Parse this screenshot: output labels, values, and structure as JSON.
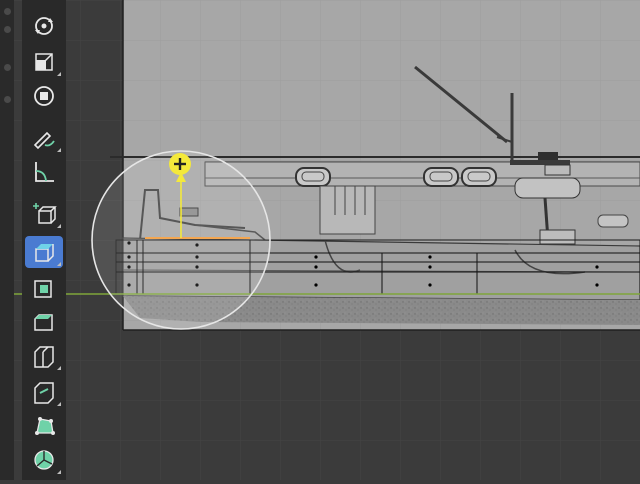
{
  "app": {
    "editor": "3D viewport"
  },
  "colors": {
    "viewport_bg": "#3b3b3b",
    "toolbar_bg": "#292929",
    "active_tool": "#4a7bd1",
    "x_axis": "#7fa63a",
    "gizmo": "#f4e93b",
    "edge_selected": "#f39b3b"
  },
  "toolbar": {
    "tools": [
      {
        "name": "tool-transform-pivot",
        "icon": "rotate-icon",
        "active": false
      },
      {
        "name": "tool-scale",
        "icon": "scale-icon",
        "active": false
      },
      {
        "name": "tool-transform",
        "icon": "transform-icon",
        "active": false
      },
      {
        "name": "tool-annotate",
        "icon": "annotate-icon",
        "active": false
      },
      {
        "name": "tool-measure",
        "icon": "measure-icon",
        "active": false
      },
      {
        "name": "tool-add-cube",
        "icon": "add-cube-icon",
        "active": false
      },
      {
        "name": "tool-extrude-region",
        "icon": "extrude-icon",
        "active": true
      },
      {
        "name": "tool-inset-faces",
        "icon": "inset-icon",
        "active": false
      },
      {
        "name": "tool-bevel",
        "icon": "bevel-icon",
        "active": false
      },
      {
        "name": "tool-loop-cut",
        "icon": "loop-cut-icon",
        "active": false
      },
      {
        "name": "tool-knife",
        "icon": "knife-icon",
        "active": false
      },
      {
        "name": "tool-poly-build",
        "icon": "poly-build-icon",
        "active": false
      },
      {
        "name": "tool-spin",
        "icon": "spin-icon",
        "active": false
      }
    ]
  }
}
